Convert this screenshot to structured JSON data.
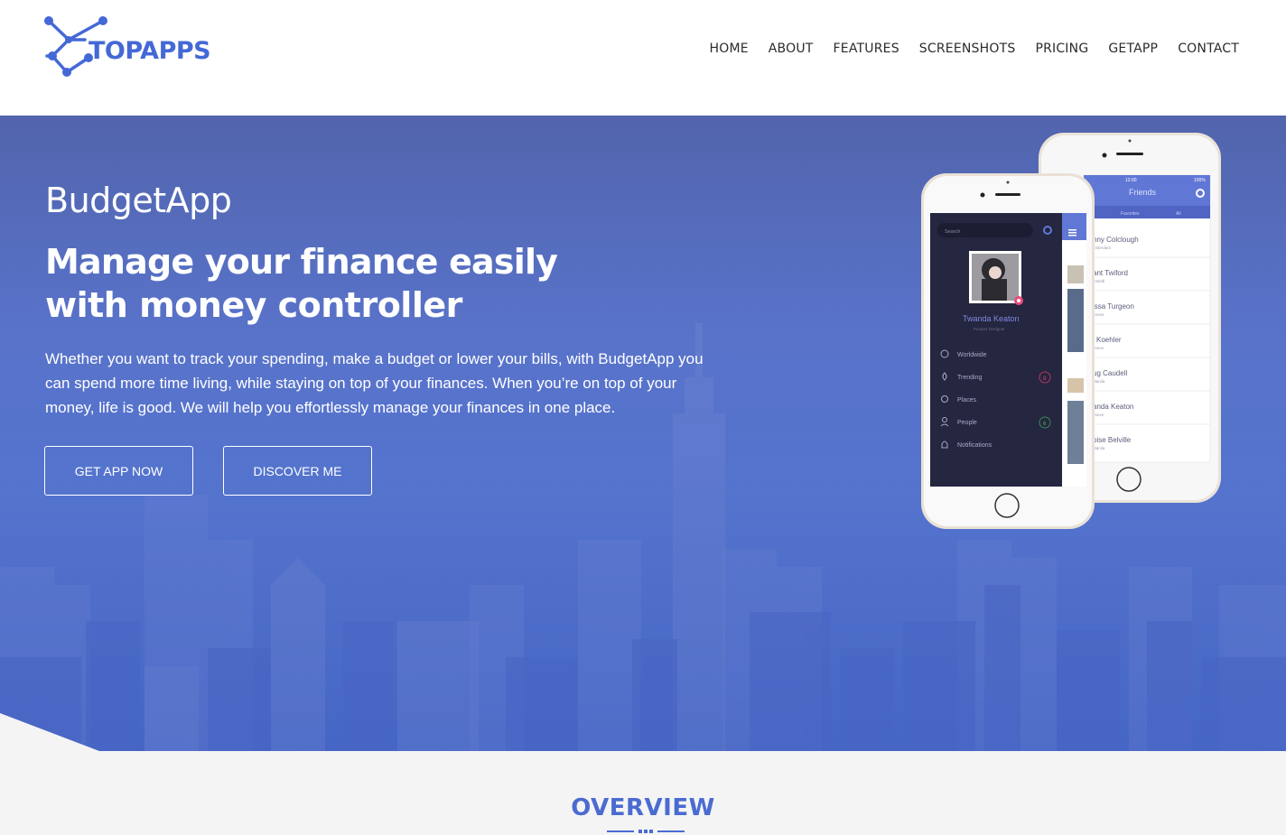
{
  "brand": {
    "name": "TOPAPPS",
    "color": "#4468d6"
  },
  "nav": {
    "items": [
      "HOME",
      "ABOUT",
      "FEATURES",
      "SCREENSHOTS",
      "PRICING",
      "GETAPP",
      "CONTACT"
    ]
  },
  "hero": {
    "title": "BudgetApp",
    "headline": "Manage your finance easily",
    "subheadline": "with money controller",
    "description": "Whether you want to track your spending, make a budget or lower your bills, with BudgetApp you can spend more time living, while staying on top of your finances. When you’re on top of your money, life is good. We will help you effortlessly manage your finances in one place.",
    "buttons": {
      "get_app": "GET APP NOW",
      "discover": "DISCOVER ME"
    }
  },
  "phone_front": {
    "search_placeholder": "Search",
    "profile_name": "Twanda Keaton",
    "profile_role": "Product Designer",
    "menu": [
      {
        "label": "Worldwide",
        "icon": "globe-icon"
      },
      {
        "label": "Trending",
        "icon": "flame-icon",
        "badge": "8"
      },
      {
        "label": "Places",
        "icon": "pin-icon"
      },
      {
        "label": "People",
        "icon": "person-icon",
        "badge": "6"
      },
      {
        "label": "Notifications",
        "icon": "bell-icon"
      }
    ]
  },
  "phone_back": {
    "status_time": "12:00",
    "status_battery": "100%",
    "title": "Friends",
    "tabs": [
      "Favorites",
      "All"
    ],
    "friends": [
      {
        "name": "nny Colclough",
        "place": "msterdam"
      },
      {
        "name": "ant Twiford",
        "place": "mstelb"
      },
      {
        "name": "issa Turgeon",
        "place": "ennes"
      },
      {
        "name": "i Koehler",
        "place": "eneve"
      },
      {
        "name": "ug Caudell",
        "place": "Manila"
      },
      {
        "name": "anda Keaton",
        "place": "eneve"
      },
      {
        "name": "oise Belville",
        "place": "Manila"
      }
    ]
  },
  "overview": {
    "title": "OVERVIEW"
  },
  "colors": {
    "accent": "#4a6bd1",
    "hero_bg": "#5874cf",
    "phone_dark": "#232440"
  }
}
